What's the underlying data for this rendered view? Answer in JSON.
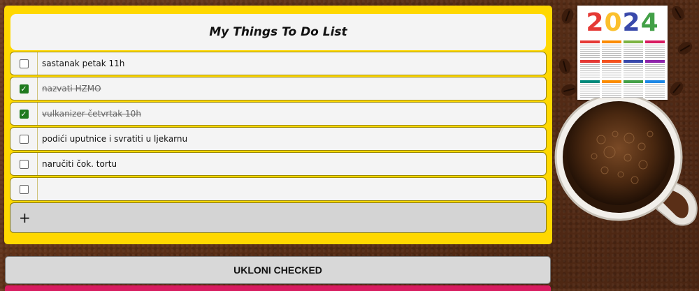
{
  "todo": {
    "title": "My Things To Do List",
    "items": [
      {
        "text": "sastanak petak 11h",
        "checked": false
      },
      {
        "text": "nazvati HZMO",
        "checked": true
      },
      {
        "text": "vulkanizer četvrtak 10h",
        "checked": true
      },
      {
        "text": "podići uputnice i svratiti u ljekarnu",
        "checked": false
      },
      {
        "text": "naručiti čok. tortu",
        "checked": false
      },
      {
        "text": "",
        "checked": false
      }
    ],
    "add_label": "+"
  },
  "actions": {
    "remove_checked_label": "UKLONI CHECKED"
  },
  "calendar": {
    "year_digits": [
      "2",
      "0",
      "2",
      "4"
    ]
  },
  "colors": {
    "panel": "#ffd800",
    "check_on": "#1f7a1f",
    "accent_bar": "#d81b60"
  }
}
